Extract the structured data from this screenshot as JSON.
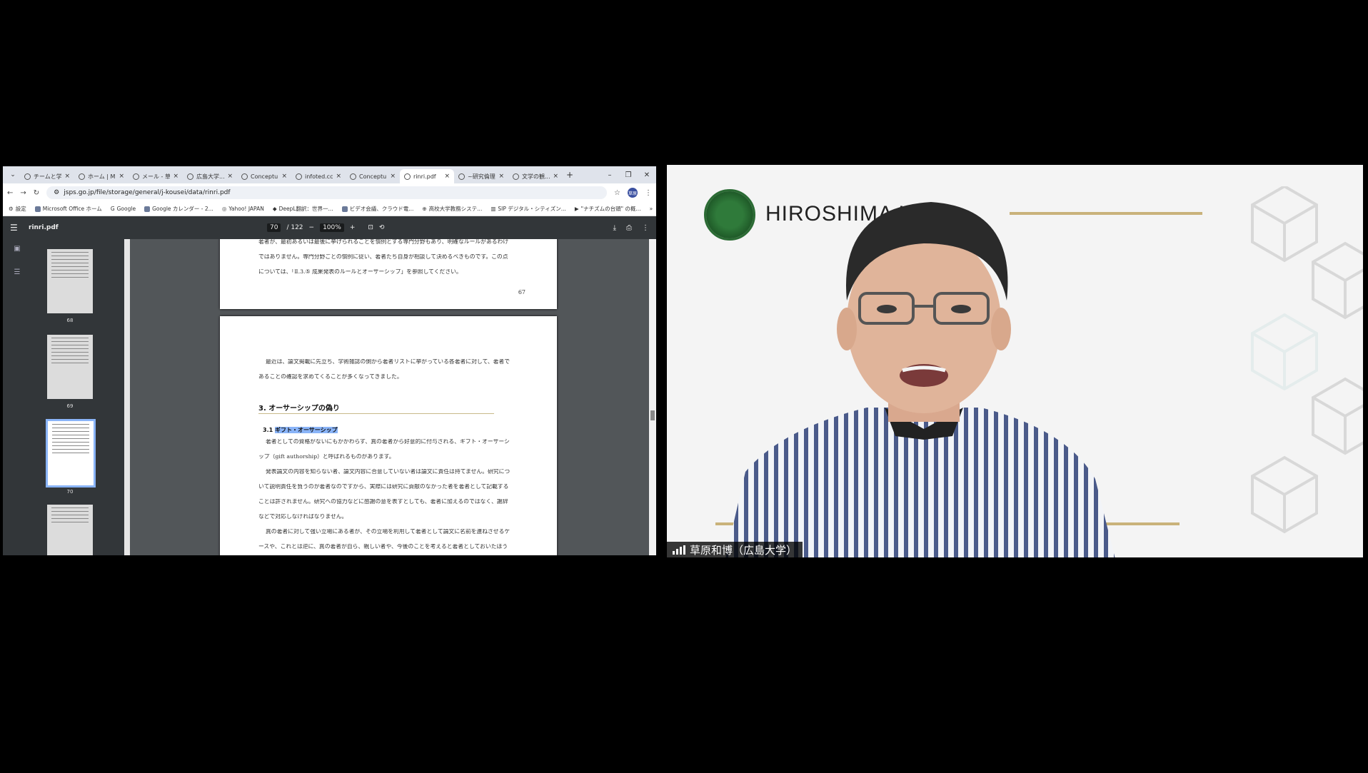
{
  "browser": {
    "tabs": [
      {
        "label": "チームと学..."
      },
      {
        "label": "ホーム | Mi..."
      },
      {
        "label": "メール - 草..."
      },
      {
        "label": "広島大学..."
      },
      {
        "label": "Conceptu..."
      },
      {
        "label": "infoted.cc..."
      },
      {
        "label": "Conceptu..."
      },
      {
        "label": "rinri.pdf"
      },
      {
        "label": "~研究倫理..."
      },
      {
        "label": "文学の観..."
      }
    ],
    "url": "jsps.go.jp/file/storage/general/j-kousei/data/rinri.pdf",
    "avatar_text": "草原",
    "bookmarks": [
      {
        "label": "設定"
      },
      {
        "label": "Microsoft Office ホーム"
      },
      {
        "label": "Google"
      },
      {
        "label": "Google カレンダー - 2..."
      },
      {
        "label": "Yahoo! JAPAN"
      },
      {
        "label": "DeepL翻訳：世界一..."
      },
      {
        "label": "ビデオ会議、クラウド電..."
      },
      {
        "label": "高校大学教務システ..."
      },
      {
        "label": "SIP デジタル・シティズン..."
      },
      {
        "label": "\"ナチズムの台頭\" の概..."
      }
    ]
  },
  "pdf": {
    "filename": "rinri.pdf",
    "page_current": "70",
    "page_total": "/ 122",
    "zoom": "100%",
    "thumbnails": [
      {
        "label": "68"
      },
      {
        "label": "69"
      },
      {
        "label": "70"
      },
      {
        "label": ""
      }
    ],
    "page67": {
      "lines": [
        "著者が、最初あるいは最後に挙げられることを慣例とする専門分野もあり、明確なルールがあるわけ",
        "ではありません。専門分野ごとの慣例に従い、著者たち自身が相談して決めるべきものです。この点",
        "については、「Ⅱ.3.⑤ 成果発表のルールとオーサーシップ」を参照してください。"
      ],
      "page_number": "67"
    },
    "page68": {
      "intro_lines": [
        "最近は、論文掲載に先立ち、学術雑誌の側から著者リストに挙がっている各著者に対して、著者で",
        "あることの確認を求めてくることが多くなってきました。"
      ],
      "heading": "3. オーサーシップの偽り",
      "sub_num": "3.1",
      "sub_title": "ギフト・オーサーシップ",
      "body_lines": [
        "著者としての資格がないにもかかわらず、真の著者から好意的に付与される、ギフト・オーサーシ",
        "ップ（gift authorship）と呼ばれるものがあります。",
        "発表論文の内容を知らない者、論文内容に合意していない者は論文に責任は持てません。研究につ",
        "いて説明責任を負うのが著者なのですから、実際には研究に貢献のなかった者を著者として記載する",
        "ことは許されません。研究への協力などに感謝の意を表すとしても、著者に加えるのではなく、謝辞",
        "などで対応しなければなりません。",
        "真の著者に対して強い立場にある者が、その立場を利用して著者として論文に名前を連ねさせるケ",
        "ースや、これとは逆に、真の著者が自ら、親しい者や、今後のことを考えると著者としておいたほう"
      ]
    }
  },
  "video": {
    "backdrop_text": "HIROSHIMA UNIV",
    "participant_name": "草原和博（広島大学）",
    "colors": {
      "gold": "#c9b27a",
      "green": "#2f7a3a"
    }
  }
}
